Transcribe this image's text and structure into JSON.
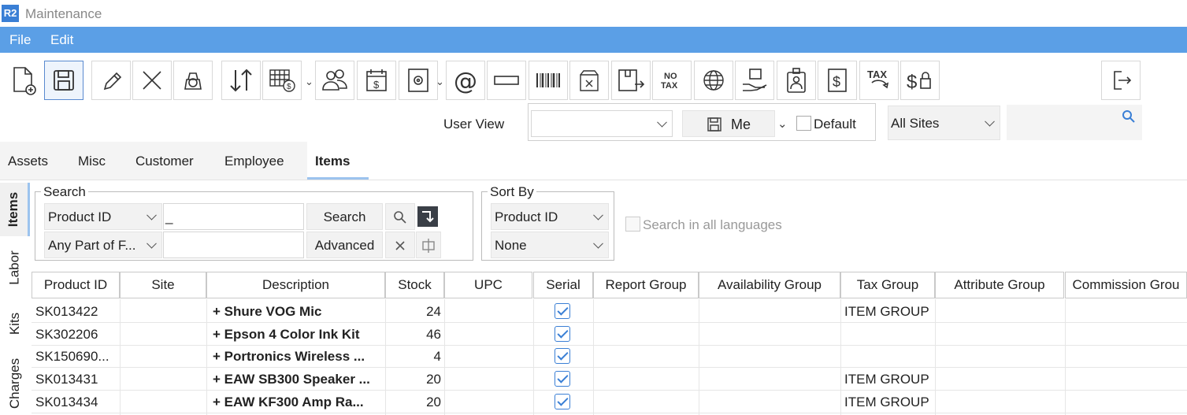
{
  "app": {
    "logo": "R2",
    "title": "Maintenance"
  },
  "menu": [
    "File",
    "Edit"
  ],
  "toolbar_icons": [
    "new-document-icon",
    "save-icon",
    "edit-icon",
    "delete-icon",
    "scale-icon",
    "sort-icon",
    "price-grid-icon",
    "users-icon",
    "calendar-price-icon",
    "settings-icon",
    "email-icon",
    "rectangle-icon",
    "barcode-icon",
    "box-delete-icon",
    "export-box-icon",
    "no-tax-icon",
    "globe-icon",
    "hand-box-icon",
    "badge-icon",
    "dollar-icon",
    "tax-icon",
    "dollar-lock-icon",
    "exit-icon"
  ],
  "toolbar_text": {
    "no_tax": "NO\nTAX",
    "tax": "TAX"
  },
  "user_view": {
    "label": "User View",
    "value": "",
    "me_label": "Me",
    "default_label": "Default",
    "sites": "All Sites",
    "search_value": ""
  },
  "tabs": [
    "Assets",
    "Misc",
    "Customer",
    "Employee",
    "Items"
  ],
  "active_tab": "Items",
  "side_tabs": [
    "Items",
    "Labor",
    "Kits",
    "Charges"
  ],
  "search": {
    "legend": "Search",
    "field": "Product ID",
    "value": "_",
    "match": "Any Part of F...",
    "value2": "",
    "search_btn": "Search",
    "advanced_btn": "Advanced"
  },
  "sort": {
    "legend": "Sort By",
    "first": "Product ID",
    "second": "None"
  },
  "search_all_languages": "Search in all languages",
  "table": {
    "headers": [
      "Product ID",
      "Site",
      "Description",
      "Stock",
      "UPC",
      "Serial",
      "Report Group",
      "Availability Group",
      "Tax Group",
      "Attribute Group",
      "Commission Grou"
    ],
    "rows": [
      {
        "id": "SK013422",
        "site": "",
        "desc": "+ Shure VOG Mic",
        "stock": "24",
        "upc": "",
        "serial": true,
        "tax": "ITEM GROUP"
      },
      {
        "id": "SK302206",
        "site": "",
        "desc": "+ Epson 4 Color Ink Kit",
        "stock": "46",
        "upc": "",
        "serial": true,
        "tax": ""
      },
      {
        "id": "SK150690...",
        "site": "",
        "desc": "+ Portronics Wireless ...",
        "stock": "4",
        "upc": "",
        "serial": true,
        "tax": ""
      },
      {
        "id": "SK013431",
        "site": "",
        "desc": "+ EAW SB300 Speaker ...",
        "stock": "20",
        "upc": "",
        "serial": true,
        "tax": "ITEM GROUP"
      },
      {
        "id": "SK013434",
        "site": "",
        "desc": "+ EAW KF300 Amp Ra...",
        "stock": "20",
        "upc": "",
        "serial": true,
        "tax": "ITEM GROUP"
      }
    ]
  },
  "colors": {
    "menubar": "#5b9fe6",
    "accent": "#3a7fd5",
    "tab_underline": "#9cc3ee"
  }
}
